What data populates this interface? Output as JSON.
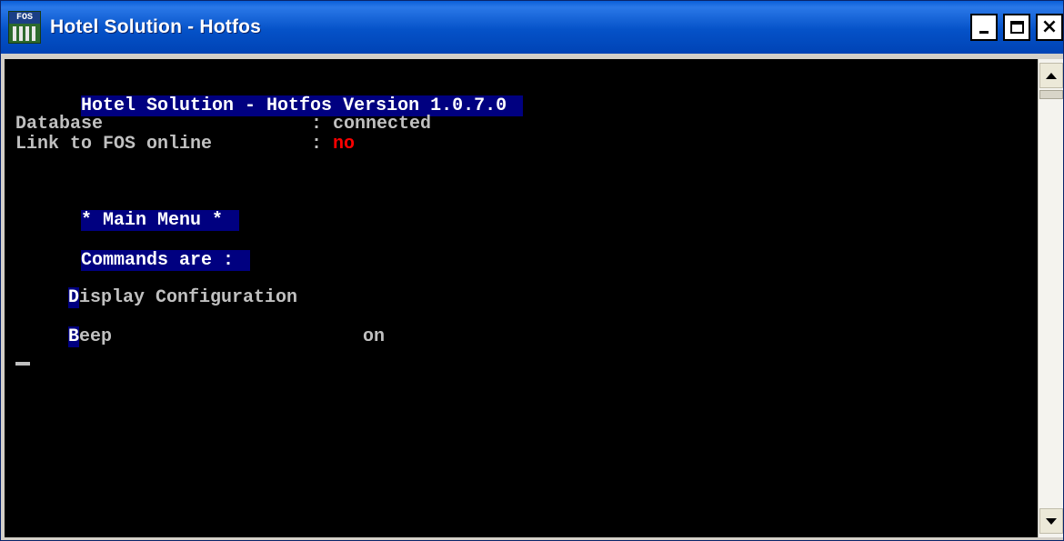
{
  "window": {
    "title": "Hotel Solution - Hotfos",
    "icon_text": "FOS",
    "icon": "hotfos-app-icon",
    "controls": {
      "minimize": "minimize-icon",
      "maximize": "maximize-icon",
      "close": "close-icon",
      "close_glyph": "×"
    }
  },
  "console": {
    "version_line": "Hotel Solution - Hotfos Version 1.0.7.0",
    "status": [
      {
        "label": "Database",
        "separator": " : ",
        "value": "connected"
      },
      {
        "label": "Link to FOS online",
        "separator": " : ",
        "value": "no"
      }
    ],
    "menu_title": "* Main Menu *",
    "commands_label": "Commands are :",
    "commands": [
      {
        "initial": "D",
        "rest": "isplay Configuration",
        "value": ""
      },
      {
        "initial": "B",
        "rest": "eep",
        "value": "on"
      }
    ],
    "colors": {
      "background": "#000000",
      "text": "#c0c0c0",
      "highlight_bg": "#000080",
      "highlight_text": "#ffffff",
      "alert": "#ff0000"
    }
  }
}
